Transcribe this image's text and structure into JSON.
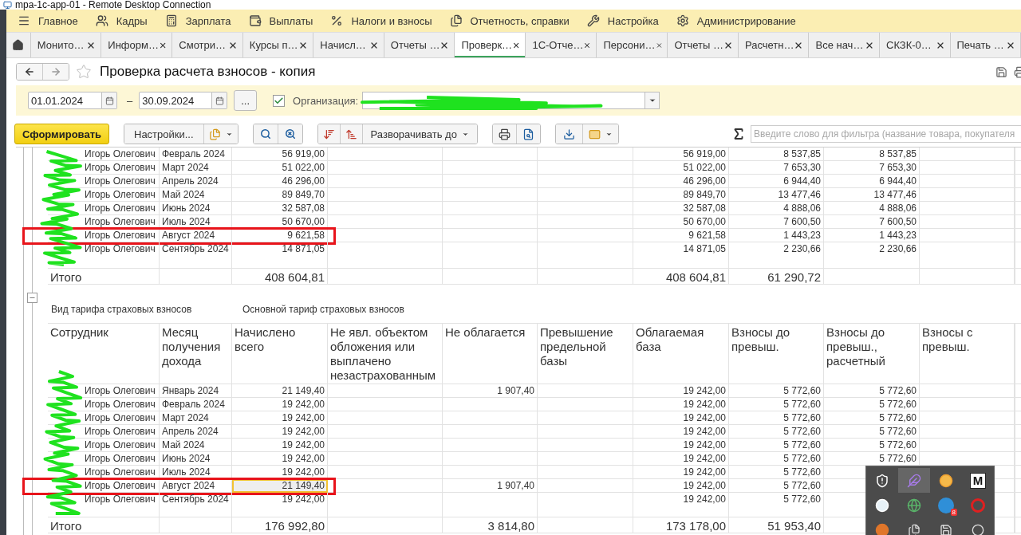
{
  "window": {
    "title": "mpa-1c-app-01 - Remote Desktop Connection"
  },
  "menu": [
    {
      "label": "Главное"
    },
    {
      "label": "Кадры"
    },
    {
      "label": "Зарплата"
    },
    {
      "label": "Выплаты"
    },
    {
      "label": "Налоги и взносы"
    },
    {
      "label": "Отчетность, справки"
    },
    {
      "label": "Настройка"
    },
    {
      "label": "Администрирование"
    }
  ],
  "tabs": [
    {
      "label": "Монито…",
      "selected": false
    },
    {
      "label": "Информ…",
      "selected": false
    },
    {
      "label": "Смотри…",
      "selected": false
    },
    {
      "label": "Курсы п…",
      "selected": false
    },
    {
      "label": "Начисл…",
      "selected": false
    },
    {
      "label": "Отчеты …",
      "selected": false
    },
    {
      "label": "Проверк…",
      "selected": true
    },
    {
      "label": "1С-Отче…",
      "selected": false
    },
    {
      "label": "Персони…",
      "selected": false
    },
    {
      "label": "Отчеты …",
      "selected": false
    },
    {
      "label": "Расчетн…",
      "selected": false
    },
    {
      "label": "Все нач…",
      "selected": false
    },
    {
      "label": "СКЗК-0…",
      "selected": false
    },
    {
      "label": "Печать …",
      "selected": false
    }
  ],
  "page": {
    "title": "Проверка расчета взносов - копия",
    "favorite": false
  },
  "filters": {
    "date_from": "01.01.2024",
    "dash": "–",
    "date_to": "30.09.2024",
    "more_button": "...",
    "org_checked": true,
    "org_label": "Организация:"
  },
  "toolbar": {
    "generate": "Сформировать",
    "settings": "Настройки...",
    "expand": "Разворачивать до",
    "filter_placeholder": "Введите слово для фильтра (название товара, покупателя"
  },
  "tray": {
    "letter_tile": "M",
    "count_badge": "8"
  },
  "report": {
    "top_rows": [
      {
        "employee": "Игорь Олегович",
        "month": "Февраль 2024",
        "accrued": "56 919,00",
        "taxable_base": "56 919,00",
        "contrib": "8 537,85",
        "contrib_calc": "8 537,85",
        "highlighted": false
      },
      {
        "employee": "Игорь Олегович",
        "month": "Март 2024",
        "accrued": "51 022,00",
        "taxable_base": "51 022,00",
        "contrib": "7 653,30",
        "contrib_calc": "7 653,30",
        "highlighted": false
      },
      {
        "employee": "Игорь Олегович",
        "month": "Апрель 2024",
        "accrued": "46 296,00",
        "taxable_base": "46 296,00",
        "contrib": "6 944,40",
        "contrib_calc": "6 944,40",
        "highlighted": false
      },
      {
        "employee": "Игорь Олегович",
        "month": "Май 2024",
        "accrued": "89 849,70",
        "taxable_base": "89 849,70",
        "contrib": "13 477,46",
        "contrib_calc": "13 477,46",
        "highlighted": false
      },
      {
        "employee": "Игорь Олегович",
        "month": "Июнь 2024",
        "accrued": "32 587,08",
        "taxable_base": "32 587,08",
        "contrib": "4 888,06",
        "contrib_calc": "4 888,06",
        "highlighted": false
      },
      {
        "employee": "Игорь Олегович",
        "month": "Июль 2024",
        "accrued": "50 670,00",
        "taxable_base": "50 670,00",
        "contrib": "7 600,50",
        "contrib_calc": "7 600,50",
        "highlighted": false
      },
      {
        "employee": "Игорь Олегович",
        "month": "Август 2024",
        "accrued": "9 621,58",
        "taxable_base": "9 621,58",
        "contrib": "1 443,23",
        "contrib_calc": "1 443,23",
        "highlighted": true
      },
      {
        "employee": "Игорь Олегович",
        "month": "Сентябрь 2024",
        "accrued": "14 871,05",
        "taxable_base": "14 871,05",
        "contrib": "2 230,66",
        "contrib_calc": "2 230,66",
        "highlighted": false
      }
    ],
    "top_total": {
      "employee": "Итого",
      "accrued": "408 604,81",
      "taxable_base": "408 604,81",
      "contrib": "61 290,72"
    },
    "tariff": {
      "label": "Вид тарифа страховых взносов",
      "value": "Основной тариф страховых взносов",
      "expanded": true
    },
    "columns": [
      "Сотрудник",
      "Месяц получения дохода",
      "Начислено всего",
      "Не явл. объектом обложения или выплачено незастрахованным",
      "Не облагается",
      "Превышение предельной базы",
      "Облагаемая база",
      "Взносы до превыш.",
      "Взносы до превыш., расчетный",
      "Взносы с превыш."
    ],
    "rows": [
      {
        "employee": "Игорь Олегович",
        "month": "Январь 2024",
        "accrued": "21 149,40",
        "exempt": "1 907,40",
        "taxable_base": "19 242,00",
        "contrib": "5 772,60",
        "contrib_calc": "5 772,60",
        "highlighted": false
      },
      {
        "employee": "Игорь Олегович",
        "month": "Февраль 2024",
        "accrued": "19 242,00",
        "taxable_base": "19 242,00",
        "contrib": "5 772,60",
        "contrib_calc": "5 772,60",
        "highlighted": false
      },
      {
        "employee": "Игорь Олегович",
        "month": "Март 2024",
        "accrued": "19 242,00",
        "taxable_base": "19 242,00",
        "contrib": "5 772,60",
        "contrib_calc": "5 772,60",
        "highlighted": false
      },
      {
        "employee": "Игорь Олегович",
        "month": "Апрель 2024",
        "accrued": "19 242,00",
        "taxable_base": "19 242,00",
        "contrib": "5 772,60",
        "contrib_calc": "5 772,60",
        "highlighted": false
      },
      {
        "employee": "Игорь Олегович",
        "month": "Май 2024",
        "accrued": "19 242,00",
        "taxable_base": "19 242,00",
        "contrib": "5 772,60",
        "contrib_calc": "5 772,60",
        "highlighted": false
      },
      {
        "employee": "Игорь Олегович",
        "month": "Июнь 2024",
        "accrued": "19 242,00",
        "taxable_base": "19 242,00",
        "contrib": "5 772,60",
        "contrib_calc": "5 772,60",
        "highlighted": false
      },
      {
        "employee": "Игорь Олегович",
        "month": "Июль 2024",
        "accrued": "19 242,00",
        "taxable_base": "19 242,00",
        "contrib": "5 772,60",
        "highlighted": false
      },
      {
        "employee": "Игорь Олегович",
        "month": "Август 2024",
        "accrued": "21 149,40",
        "exempt": "1 907,40",
        "taxable_base": "19 242,00",
        "contrib": "5 772,60",
        "highlighted": true,
        "accrued_cursor": true
      },
      {
        "employee": "Игорь Олегович",
        "month": "Сентябрь 2024",
        "accrued": "19 242,00",
        "taxable_base": "19 242,00",
        "contrib": "5 772,60",
        "highlighted": false
      }
    ],
    "total": {
      "employee": "Итого",
      "accrued": "176 992,80",
      "exempt": "3 814,80",
      "taxable_base": "173 178,00",
      "contrib": "51 953,40"
    }
  }
}
